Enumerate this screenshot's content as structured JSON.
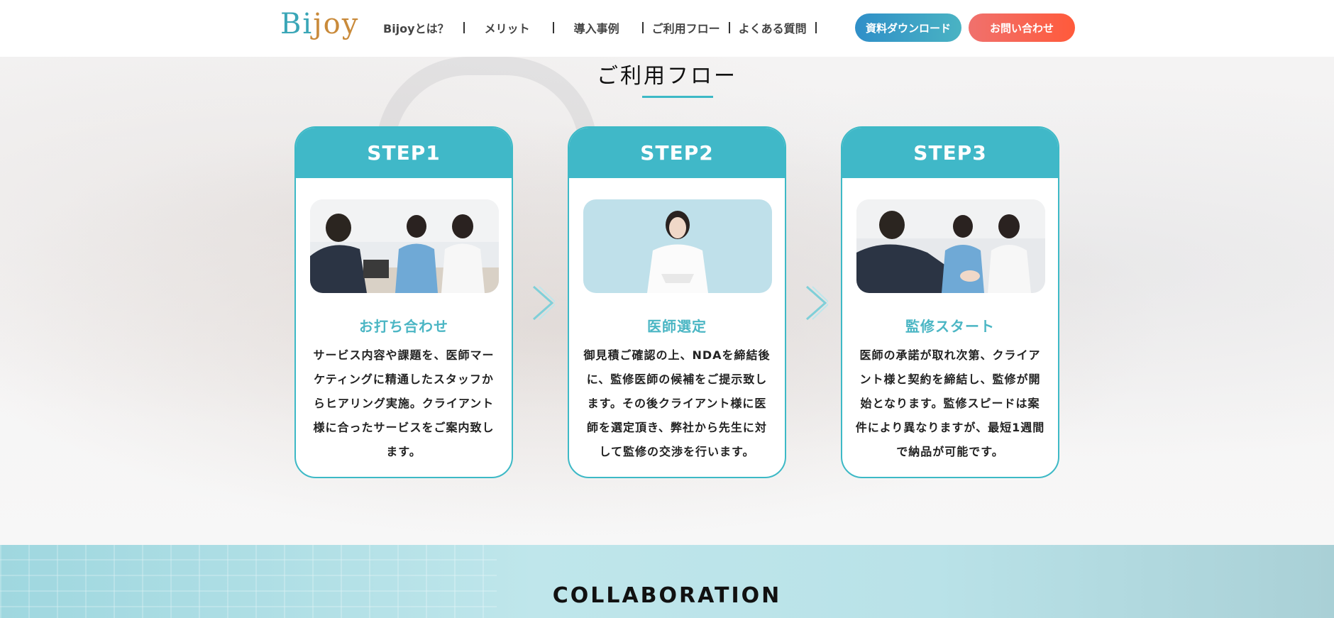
{
  "header": {
    "logo_text": "Bijoy",
    "nav": [
      {
        "label": "Bijoyとは？"
      },
      {
        "label": "メリット"
      },
      {
        "label": "導入事例"
      },
      {
        "label": "ご利用フロー"
      },
      {
        "label": "よくある質問"
      }
    ],
    "download_button": "資料ダウンロード",
    "contact_button": "お問い合わせ"
  },
  "flow": {
    "title": "ご利用フロー",
    "steps": [
      {
        "label": "STEP1",
        "subtitle": "お打ち合わせ",
        "text": "サービス内容や課題を、医師マーケティングに精通したスタッフからヒアリング実施。クライアント様に合ったサービスをご案内致します。"
      },
      {
        "label": "STEP2",
        "subtitle": "医師選定",
        "text": "御見積ご確認の上、NDAを締結後に、監修医師の候補をご提示致します。その後クライアント様に医師を選定頂き、弊社から先生に対して監修の交渉を行います。"
      },
      {
        "label": "STEP3",
        "subtitle": "監修スタート",
        "text": "医師の承諾が取れ次第、クライアント様と契約を締結し、監修が開始となります。監修スピードは案件により異なりますが、最短1週間で納品が可能です。"
      }
    ]
  },
  "collaboration": {
    "title": "COLLABORATION"
  },
  "colors": {
    "accent": "#40b8c8",
    "download": "#2f8fc8",
    "contact": "#ff5a3b"
  }
}
